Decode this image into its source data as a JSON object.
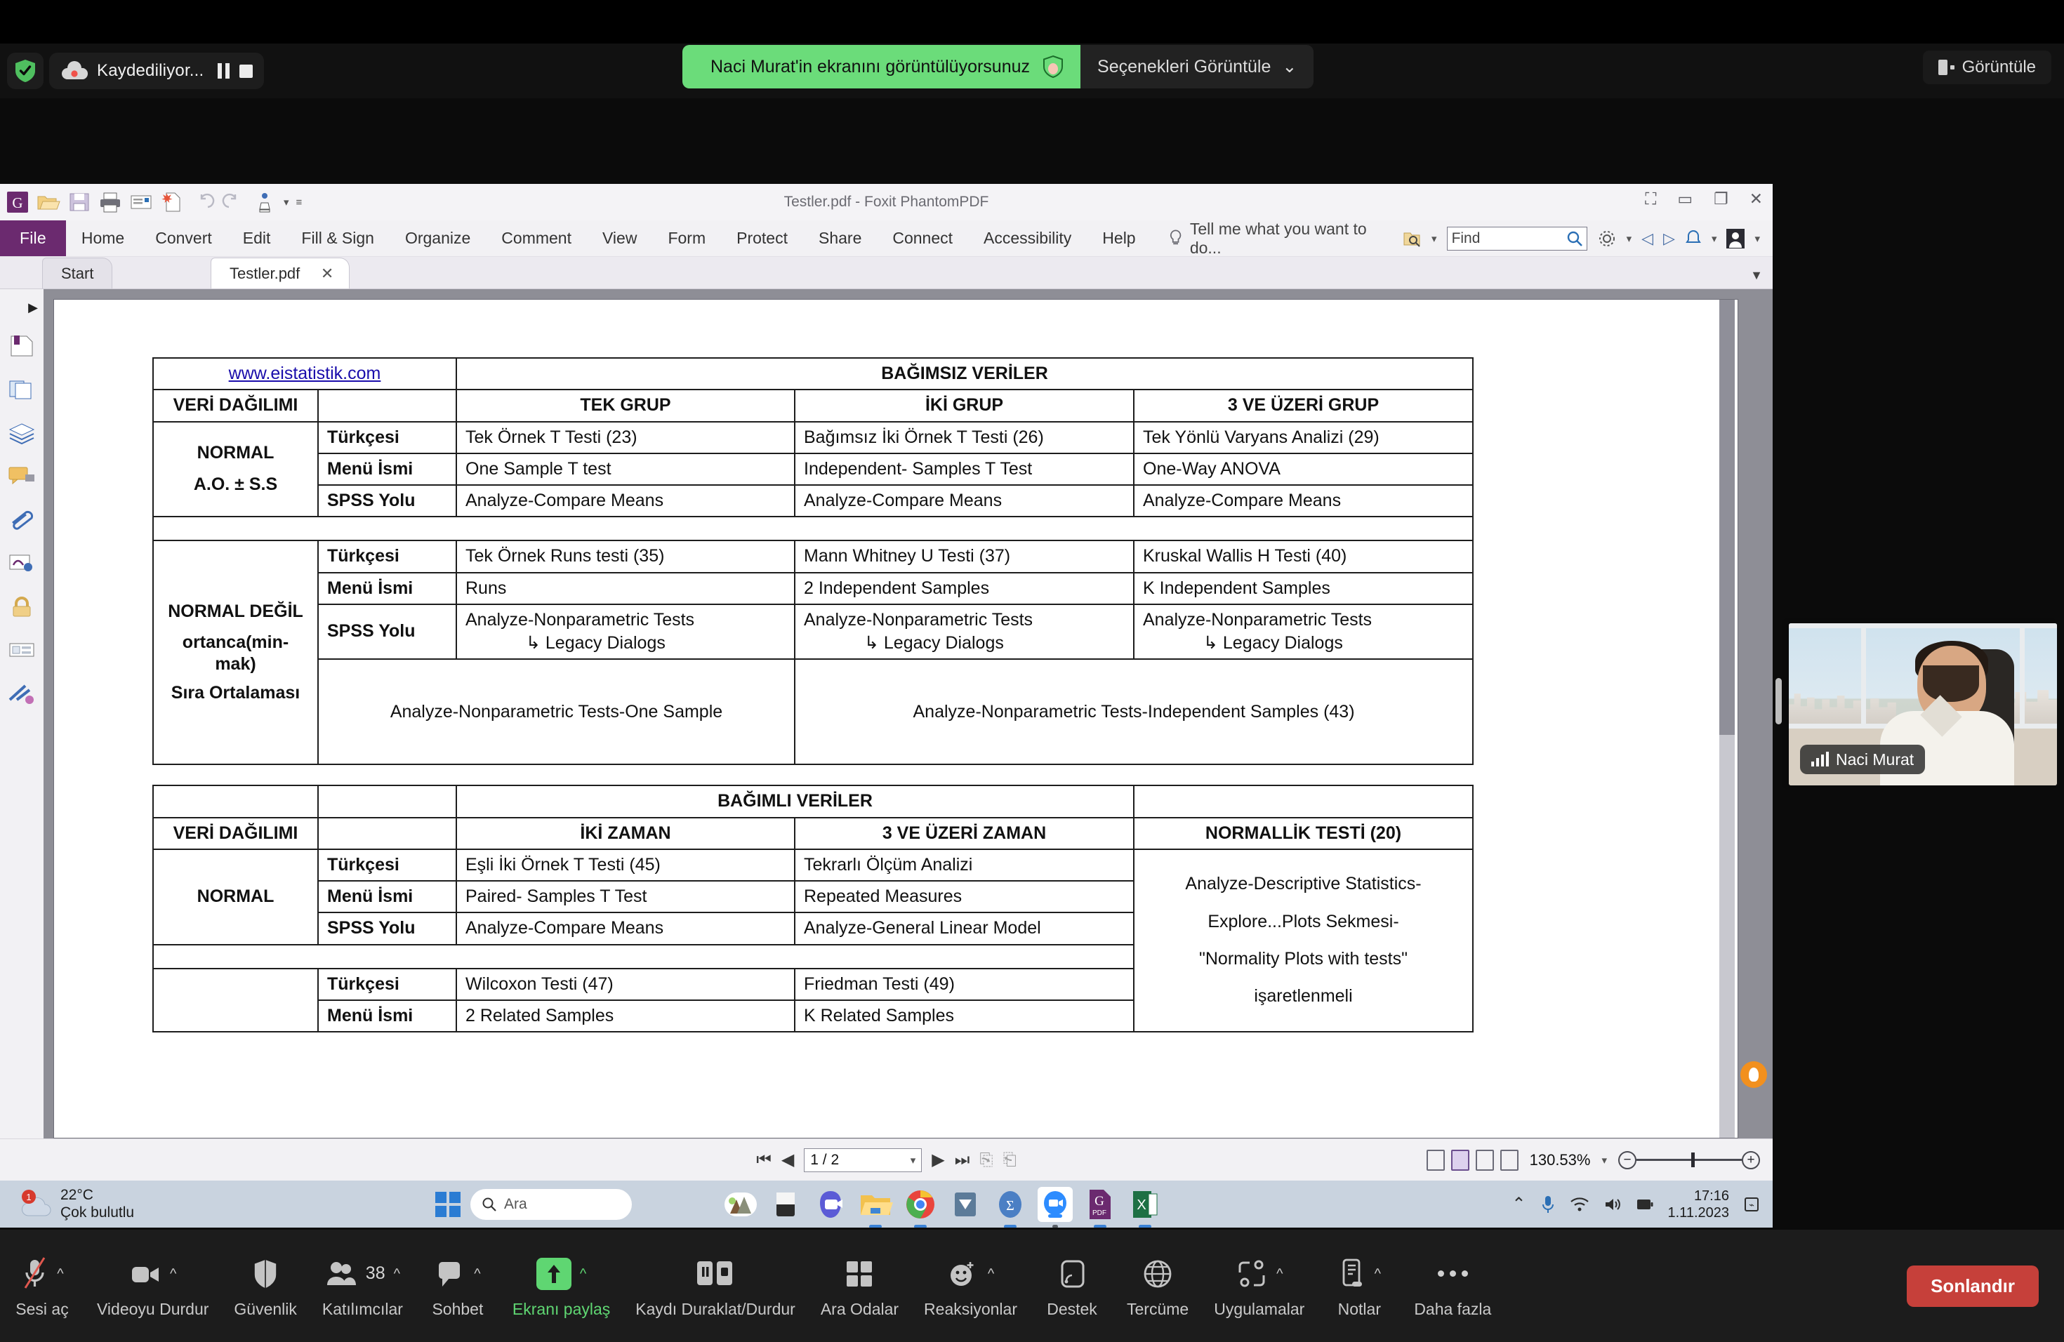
{
  "zoom_top": {
    "recording_label": "Kaydediliyor...",
    "share_banner_text": "Naci Murat'in ekranını görüntülüyorsunuz",
    "view_options_label": "Seçenekleri Görüntüle",
    "view_button_label": "Görüntüle"
  },
  "foxit": {
    "window_title": "Testler.pdf - Foxit PhantomPDF",
    "ribbon_tabs": [
      "File",
      "Home",
      "Convert",
      "Edit",
      "Fill & Sign",
      "Organize",
      "Comment",
      "View",
      "Form",
      "Protect",
      "Share",
      "Connect",
      "Accessibility",
      "Help"
    ],
    "tellme_placeholder": "Tell me what you want to do...",
    "find_placeholder": "Find",
    "doc_tabs": [
      {
        "label": "Start",
        "active": false
      },
      {
        "label": "Testler.pdf",
        "active": true,
        "close": "✕"
      }
    ],
    "status": {
      "page_value": "1 / 2",
      "zoom_level": "130.53%"
    }
  },
  "pdf": {
    "source_link": "www.eistatistik.com",
    "independent": {
      "title": "BAĞIMSIZ VERİLER",
      "distribution_header": "VERİ DAĞILIMI",
      "columns": [
        "TEK GRUP",
        "İKİ GRUP",
        "3 VE ÜZERİ GRUP"
      ],
      "normal_label": "NORMAL",
      "normal_sub": "A.O. ± S.S",
      "rows": [
        {
          "label": "Türkçesi",
          "cells": [
            "Tek Örnek T Testi (23)",
            "Bağımsız İki Örnek T Testi (26)",
            "Tek Yönlü Varyans Analizi (29)"
          ]
        },
        {
          "label": "Menü İsmi",
          "cells": [
            "One Sample T test",
            "Independent- Samples T Test",
            "One-Way ANOVA"
          ]
        },
        {
          "label": "SPSS Yolu",
          "cells": [
            "Analyze-Compare Means",
            "Analyze-Compare Means",
            "Analyze-Compare Means"
          ]
        }
      ],
      "notnormal_label": "NORMAL DEĞİL",
      "notnormal_sub1": "ortanca(min-mak)",
      "notnormal_sub2": "Sıra Ortalaması",
      "rows_nn": [
        {
          "label": "Türkçesi",
          "cells": [
            "Tek Örnek Runs testi (35)",
            "Mann Whitney U Testi (37)",
            "Kruskal Wallis H Testi (40)"
          ]
        },
        {
          "label": "Menü İsmi",
          "cells": [
            "Runs",
            "2 Independent Samples",
            "K Independent Samples"
          ]
        }
      ],
      "spss_label": "SPSS Yolu",
      "spss_main": "Analyze-Nonparametric Tests",
      "spss_legacy": "Legacy Dialogs",
      "wide_left": "Analyze-Nonparametric Tests-One Sample",
      "wide_right": "Analyze-Nonparametric Tests-Independent Samples (43)"
    },
    "dependent": {
      "title": "BAĞIMLI VERİLER",
      "distribution_header": "VERİ DAĞILIMI",
      "columns": [
        "İKİ ZAMAN",
        "3 VE ÜZERİ ZAMAN"
      ],
      "normality_header": "NORMALLİK TESTİ (20)",
      "normality_body": "Analyze-Descriptive Statistics-Explore...Plots Sekmesi-\"Normality Plots with tests\" işaretlenmeli",
      "normality_lines": [
        "Analyze-Descriptive Statistics-",
        "Explore...Plots Sekmesi-",
        "\"Normality Plots with tests\"",
        "işaretlenmeli"
      ],
      "normal_label": "NORMAL",
      "rows": [
        {
          "label": "Türkçesi",
          "cells": [
            "Eşli İki Örnek T Testi (45)",
            "Tekrarlı Ölçüm Analizi"
          ]
        },
        {
          "label": "Menü İsmi",
          "cells": [
            "Paired- Samples T Test",
            "Repeated Measures"
          ]
        },
        {
          "label": "SPSS Yolu",
          "cells": [
            "Analyze-Compare Means",
            "Analyze-General Linear Model"
          ]
        }
      ],
      "rows_nn": [
        {
          "label": "Türkçesi",
          "cells": [
            "Wilcoxon Testi (47)",
            "Friedman Testi (49)"
          ]
        },
        {
          "label": "Menü İsmi",
          "cells": [
            "2 Related Samples",
            "K Related Samples"
          ]
        }
      ]
    }
  },
  "taskbar": {
    "weather_temp": "22°C",
    "weather_desc": "Çok bulutlu",
    "weather_badge": "1",
    "search_placeholder": "Ara",
    "clock_time": "17:16",
    "clock_date": "1.11.2023"
  },
  "video": {
    "participant_name": "Naci Murat"
  },
  "zoom_controls": {
    "items": [
      {
        "label": "Sesi aç",
        "icon": "mic-muted-icon",
        "caret": true,
        "green": false
      },
      {
        "label": "Videoyu Durdur",
        "icon": "video-icon",
        "caret": true,
        "green": false
      },
      {
        "label": "Güvenlik",
        "icon": "shield-icon",
        "caret": false,
        "green": false
      },
      {
        "label": "Katılımcılar",
        "icon": "participants-icon",
        "caret": true,
        "green": false,
        "count": "38"
      },
      {
        "label": "Sohbet",
        "icon": "chat-icon",
        "caret": true,
        "green": false
      },
      {
        "label": "Ekranı paylaş",
        "icon": "share-screen-icon",
        "caret": true,
        "green": true
      },
      {
        "label": "Kaydı Duraklat/Durdur",
        "icon": "record-pause-stop-icon",
        "caret": false,
        "green": false
      },
      {
        "label": "Ara Odalar",
        "icon": "breakout-rooms-icon",
        "caret": false,
        "green": false
      },
      {
        "label": "Reaksiyonlar",
        "icon": "reactions-icon",
        "caret": true,
        "green": false
      },
      {
        "label": "Destek",
        "icon": "support-icon",
        "caret": false,
        "green": false
      },
      {
        "label": "Tercüme",
        "icon": "globe-icon",
        "caret": false,
        "green": false
      },
      {
        "label": "Uygulamalar",
        "icon": "apps-icon",
        "caret": true,
        "green": false
      },
      {
        "label": "Notlar",
        "icon": "notes-icon",
        "caret": true,
        "green": false
      },
      {
        "label": "Daha fazla",
        "icon": "more-icon",
        "caret": false,
        "green": false
      }
    ],
    "end_label": "Sonlandır"
  }
}
